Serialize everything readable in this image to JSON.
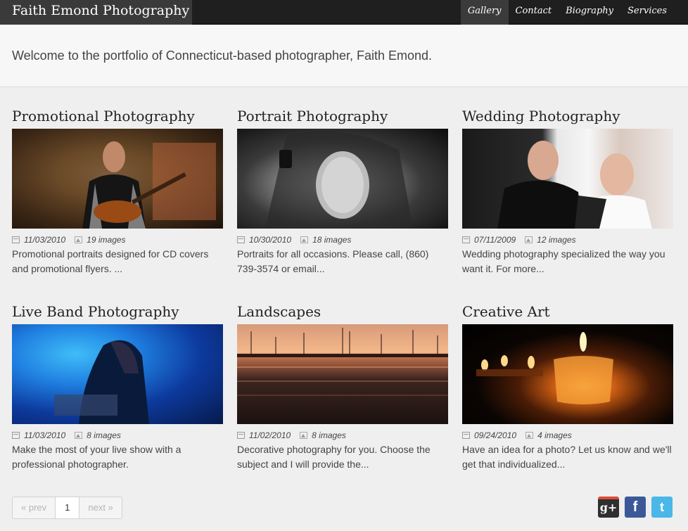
{
  "header": {
    "brand": "Faith Emond Photography",
    "nav": [
      "Gallery",
      "Contact",
      "Biography",
      "Services"
    ],
    "active": "Gallery"
  },
  "hero": {
    "text": "Welcome to the portfolio of Connecticut-based photographer, Faith Emond."
  },
  "galleries": [
    {
      "title": "Promotional Photography",
      "date": "11/03/2010",
      "images": "19 images",
      "desc": "Promotional portraits designed for CD covers and promotional flyers. ..."
    },
    {
      "title": "Portrait Photography",
      "date": "10/30/2010",
      "images": "18 images",
      "desc": "Portraits for all occasions. Please call, (860) 739-3574 or email..."
    },
    {
      "title": "Wedding Photography",
      "date": "07/11/2009",
      "images": "12 images",
      "desc": "Wedding photography specialized the way you want it. For more..."
    },
    {
      "title": "Live Band Photography",
      "date": "11/03/2010",
      "images": "8 images",
      "desc": "Make the most of your live show with a professional photographer."
    },
    {
      "title": "Landscapes",
      "date": "11/02/2010",
      "images": "8 images",
      "desc": "Decorative photography for you. Choose the subject and I will provide the..."
    },
    {
      "title": "Creative Art",
      "date": "09/24/2010",
      "images": "4 images",
      "desc": "Have an idea for a photo? Let us know and we'll get that individualized..."
    }
  ],
  "pagination": {
    "prev": "« prev",
    "current": "1",
    "next": "next »"
  },
  "social": {
    "google": "g+",
    "facebook": "f",
    "twitter": "t"
  }
}
